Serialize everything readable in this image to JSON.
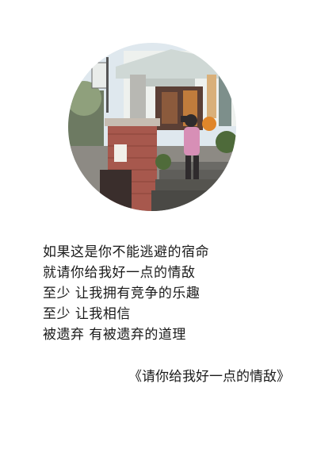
{
  "photo": {
    "icon": "street-photo",
    "colors": {
      "sky": "#dfe8ee",
      "brick": "#a7584d",
      "sweater": "#d78fb6",
      "pumpkin": "#e0862a",
      "shadow": "#2f2b2d"
    }
  },
  "lyrics": {
    "lines": [
      "如果这是你不能逃避的宿命",
      "就请你给我好一点的情敌",
      "至少 让我拥有竞争的乐趣",
      "至少 让我相信",
      "被遗弃 有被遗弃的道理"
    ]
  },
  "song": {
    "title": "《请你给我好一点的情敌》"
  }
}
